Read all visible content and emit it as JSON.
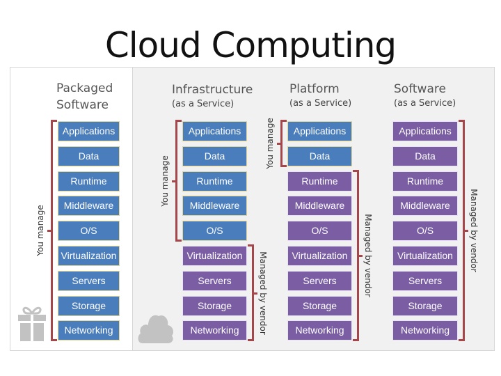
{
  "title": "Cloud Computing",
  "layers": [
    "Applications",
    "Data",
    "Runtime",
    "Middleware",
    "O/S",
    "Virtualization",
    "Servers",
    "Storage",
    "Networking"
  ],
  "labels": {
    "you_manage": "You manage",
    "managed_by_vendor": "Managed by vendor"
  },
  "colors": {
    "you_manage": "#4a7dbb",
    "vendor": "#7a5da3",
    "bracket": "#a5474a"
  },
  "columns": [
    {
      "id": "packaged",
      "heading_line1": "Packaged",
      "heading_line2": "Software",
      "subtitle": "",
      "you_manage_count": 9,
      "icon": "gift-icon"
    },
    {
      "id": "iaas",
      "heading_line1": "Infrastructure",
      "heading_line2": "",
      "subtitle": "(as a Service)",
      "you_manage_count": 5,
      "icon": "cloud-icon"
    },
    {
      "id": "paas",
      "heading_line1": "Platform",
      "heading_line2": "",
      "subtitle": "(as a Service)",
      "you_manage_count": 2
    },
    {
      "id": "saas",
      "heading_line1": "Software",
      "heading_line2": "",
      "subtitle": "(as a Service)",
      "you_manage_count": 0
    }
  ]
}
